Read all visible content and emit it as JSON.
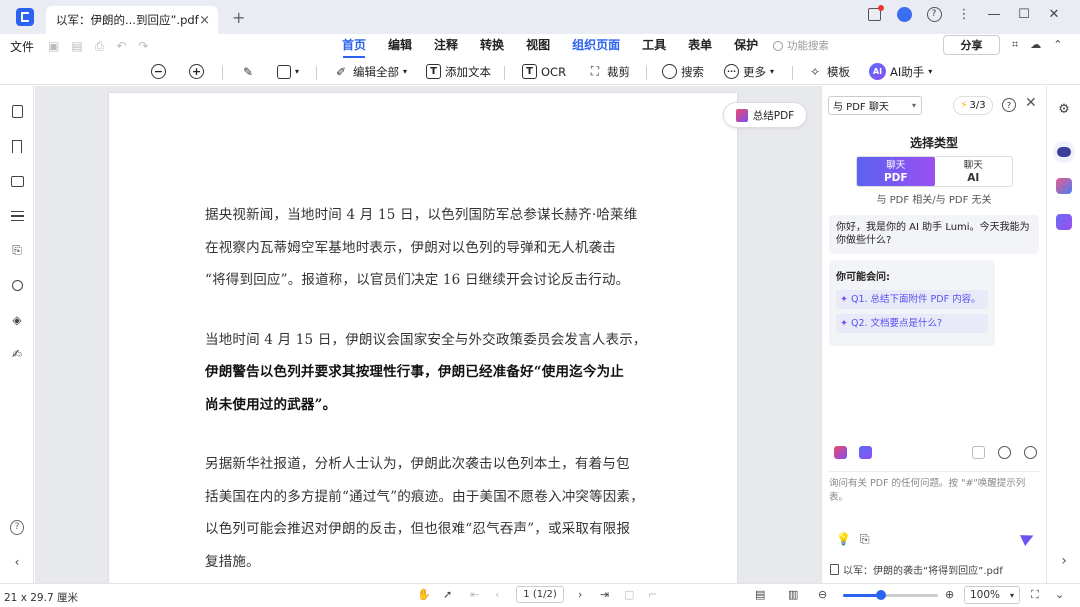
{
  "window": {
    "tab_title": "以军：伊朗的...到回应”.pdf",
    "tab_close": "×",
    "new_tab": "+"
  },
  "menu": {
    "file": "文件",
    "tabs": [
      "首页",
      "编辑",
      "注释",
      "转换",
      "视图",
      "组织页面",
      "工具",
      "表单",
      "保护"
    ],
    "active_tab": "首页",
    "search_placeholder": "功能搜索",
    "share": "分享"
  },
  "toolbar": {
    "edit_all": "编辑全部",
    "add_text": "添加文本",
    "ocr": "OCR",
    "crop": "裁剪",
    "search": "搜索",
    "more": "更多",
    "template": "模板",
    "ai_assistant": "AI助手",
    "ai_badge": "AI"
  },
  "document": {
    "summary_button": "总结PDF",
    "paragraphs": [
      {
        "bold": false,
        "lines": [
          "据央视新闻，当地时间 4 月 15 日，以色列国防军总参谋长赫齐·哈莱维",
          "在视察内瓦蒂姆空军基地时表示，伊朗对以色列的导弹和无人机袭击",
          "“将得到回应”。报道称，以官员们决定 16 日继续开会讨论反击行动。"
        ]
      },
      {
        "bold": false,
        "lines": [
          "当地时间 4 月 15 日，伊朗议会国家安全与外交政策委员会发言人表示，"
        ]
      },
      {
        "bold": true,
        "lines": [
          "伊朗警告以色列并要求其按理性行事，伊朗已经准备好“使用迄今为止",
          "尚未使用过的武器”。"
        ]
      },
      {
        "bold": false,
        "lines": [
          "另据新华社报道，分析人士认为，伊朗此次袭击以色列本土，有着与包",
          "括美国在内的多方提前“通过气”的痕迹。由于美国不愿卷入冲突等因素，",
          "以色列可能会推迟对伊朗的反击，但也很难“忍气吞声”，或采取有限报",
          "复措施。"
        ]
      }
    ]
  },
  "chat": {
    "mode_select": "与 PDF 聊天",
    "quota": "3/3",
    "title": "选择类型",
    "option_pdf_top": "聊天",
    "option_pdf_bottom": "PDF",
    "option_ai_top": "聊天",
    "option_ai_bottom": "AI",
    "caption": "与 PDF 相关/与 PDF 无关",
    "greeting": "你好，我是你的 AI 助手 Lumi。今天我能为你做些什么?",
    "suggest_title": "你可能会问:",
    "questions": [
      "Q1. 总结下面附件 PDF 内容。",
      "Q2. 文档要点是什么?"
    ],
    "input_placeholder": "询问有关 PDF 的任何问题。按 \"#\"唤醒提示列表。",
    "attached_file": "以军：伊朗的袭击“将得到回应”.pdf"
  },
  "status": {
    "page_size": "21 x 29.7 厘米",
    "page_indicator": "1 (1/2)",
    "zoom": "100%",
    "zoom_fraction": 0.4
  },
  "colors": {
    "accent": "#2b62f0",
    "ai_gradient_start": "#5b63f3",
    "ai_gradient_end": "#9a4ff0"
  }
}
